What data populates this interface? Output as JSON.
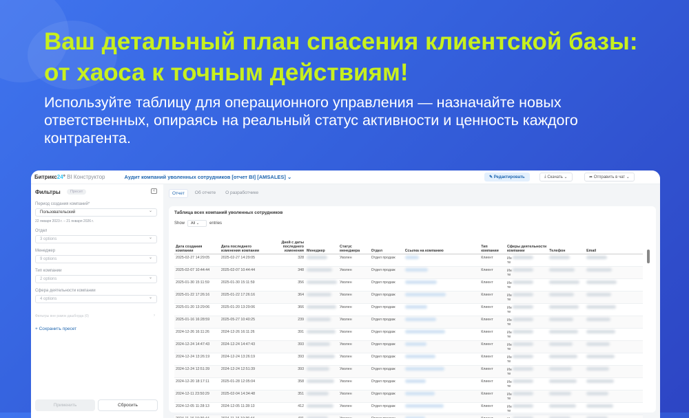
{
  "headline": "Ваш детальный план спасения клиентской базы: от хаоса к точным действиям!",
  "subtitle": "Используйте таблицу для операционного управления — назначайте новых ответственных, опираясь на реальный статус активности и ценность каждого контрагента.",
  "app": {
    "brand": "Битрикс",
    "brand_num": "24",
    "brand_sub": "BI Конструктор",
    "report_title": "Аудит компаний уволенных сотрудников [отчет BI] [AMSALES]",
    "edit": "Редактировать",
    "download": "Скачать",
    "send": "Отправить в чат"
  },
  "filters": {
    "title": "Фильтры",
    "preset": "Пресет",
    "period_label": "Период создания компаний*",
    "period_value": "Пользовательский",
    "period_range": "22 января 2023 г. – 21 января 2026 г.",
    "dept_label": "Отдел",
    "dept_value": "3 options",
    "manager_label": "Менеджер",
    "manager_value": "9 options",
    "type_label": "Тип компании",
    "type_value": "2 options",
    "sphere_label": "Сфера деятельности компании",
    "sphere_value": "4 options",
    "outside": "Фильтры вне рамок дашборда (0)",
    "save_preset": "+ Сохранить пресет",
    "apply": "Применить",
    "reset": "Сбросить"
  },
  "tabs": [
    "Отчет",
    "Об отчете",
    "О разработчике"
  ],
  "table": {
    "title": "Таблица всех компаний уволенных сотрудников",
    "show": "Show",
    "show_value": "All",
    "entries": "entries",
    "headers": [
      "Дата создания компании",
      "Дата последнего изменения компании",
      "Дней с даты последнего изменения",
      "Менеджер",
      "Статус менеджера",
      "Отдел",
      "Ссылка на компанию",
      "Тип компании",
      "Сферы деятельности компании",
      "Телефон",
      "Email"
    ],
    "rows": [
      [
        "2025-02-27 14:29:05",
        "2025-02-27 14:29:05",
        "328"
      ],
      [
        "2025-02-07 10:44:44",
        "2025-02-07 10:44:44",
        "348"
      ],
      [
        "2025-01-30 15:11:59",
        "2025-01-30 15:11:59",
        "356"
      ],
      [
        "2025-01-22 17:26:16",
        "2025-01-22 17:26:16",
        "364"
      ],
      [
        "2025-01-20 13:29:06",
        "2025-01-20 13:29:06",
        "366"
      ],
      [
        "2025-01-16 16:28:59",
        "2025-05-27 10:40:25",
        "239"
      ],
      [
        "2024-12-26 16:11:26",
        "2024-12-26 16:11:26",
        "391"
      ],
      [
        "2024-12-24 14:47:43",
        "2024-12-24 14:47:43",
        "393"
      ],
      [
        "2024-12-24 13:26:19",
        "2024-12-24 13:26:19",
        "393"
      ],
      [
        "2024-12-24 12:51:39",
        "2024-12-24 12:51:39",
        "393"
      ],
      [
        "2024-12-20 18:17:11",
        "2025-01-28 12:05:04",
        "358"
      ],
      [
        "2024-12-11 23:50:29",
        "2025-02-04 14:34:48",
        "351"
      ],
      [
        "2024-12-05 11:28:13",
        "2024-12-05 11:28:13",
        "412"
      ],
      [
        "2024-11-16 10:36:44",
        "2024-11-16 10:36:44",
        "431"
      ]
    ],
    "status": "Уволен",
    "dept": "Отдел продаж",
    "type": "Клиент",
    "sphere_prefix": "Ин",
    "sphere_suffix": "те"
  }
}
